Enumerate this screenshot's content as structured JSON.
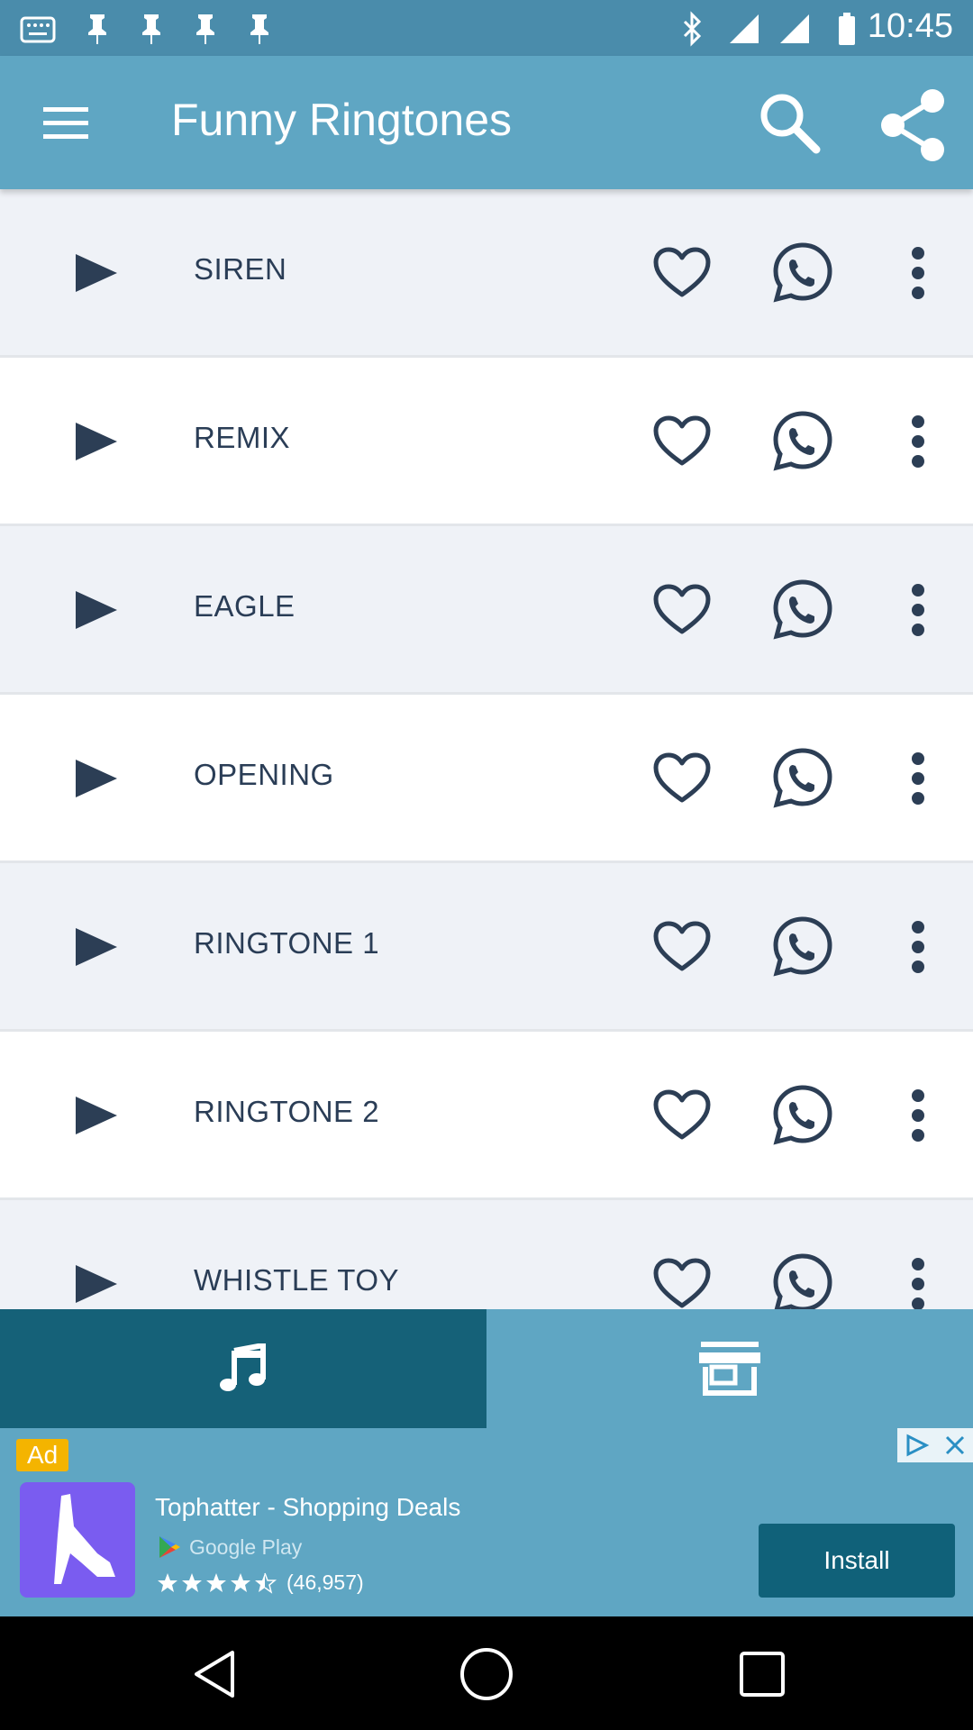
{
  "status_bar": {
    "time": "10:45"
  },
  "app_bar": {
    "title": "Funny Ringtones"
  },
  "ringtones": [
    {
      "name": "SIREN"
    },
    {
      "name": "REMIX"
    },
    {
      "name": "EAGLE"
    },
    {
      "name": "OPENING"
    },
    {
      "name": "RINGTONE 1"
    },
    {
      "name": "RINGTONE 2"
    },
    {
      "name": "WHISTLE TOY"
    }
  ],
  "tabs": [
    {
      "icon": "music-note-icon",
      "active": true
    },
    {
      "icon": "store-icon",
      "active": false
    }
  ],
  "ad": {
    "label": "Ad",
    "title": "Tophatter - Shopping Deals",
    "store": "Google Play",
    "rating_count": "(46,957)",
    "install_label": "Install"
  },
  "colors": {
    "app_bar": "#5fa6c3",
    "status_bar": "#4a8cab",
    "active_tab": "#156178",
    "icon_dark": "#2c3e55",
    "row_alt": "#eff2f7"
  }
}
